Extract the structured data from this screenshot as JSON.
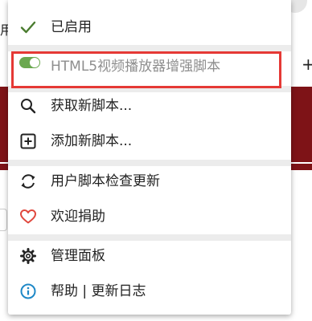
{
  "background": {
    "partial_text": "用",
    "plus_glyph": "+",
    "band_color": "#7e1317"
  },
  "menu": {
    "status": {
      "label": "已启用",
      "icon": "check-icon",
      "color": "#4a7c2f"
    },
    "script": {
      "label": "HTML5视频播放器增强脚本",
      "enabled": true,
      "toggle_color": "#6aa84f"
    },
    "find_scripts": {
      "label": "获取新脚本...",
      "icon": "search-icon"
    },
    "add_script": {
      "label": "添加新脚本...",
      "icon": "plus-square-icon"
    },
    "check_updates": {
      "label": "用户脚本检查更新",
      "icon": "refresh-icon"
    },
    "donate": {
      "label": "欢迎捐助",
      "icon": "heart-icon",
      "color": "#e0483e"
    },
    "dashboard": {
      "label": "管理面板",
      "icon": "gear-icon"
    },
    "help": {
      "label": "帮助 | 更新日志",
      "icon": "info-icon",
      "color": "#1e88c7"
    }
  },
  "annotation": {
    "highlight_color": "#e53935"
  }
}
